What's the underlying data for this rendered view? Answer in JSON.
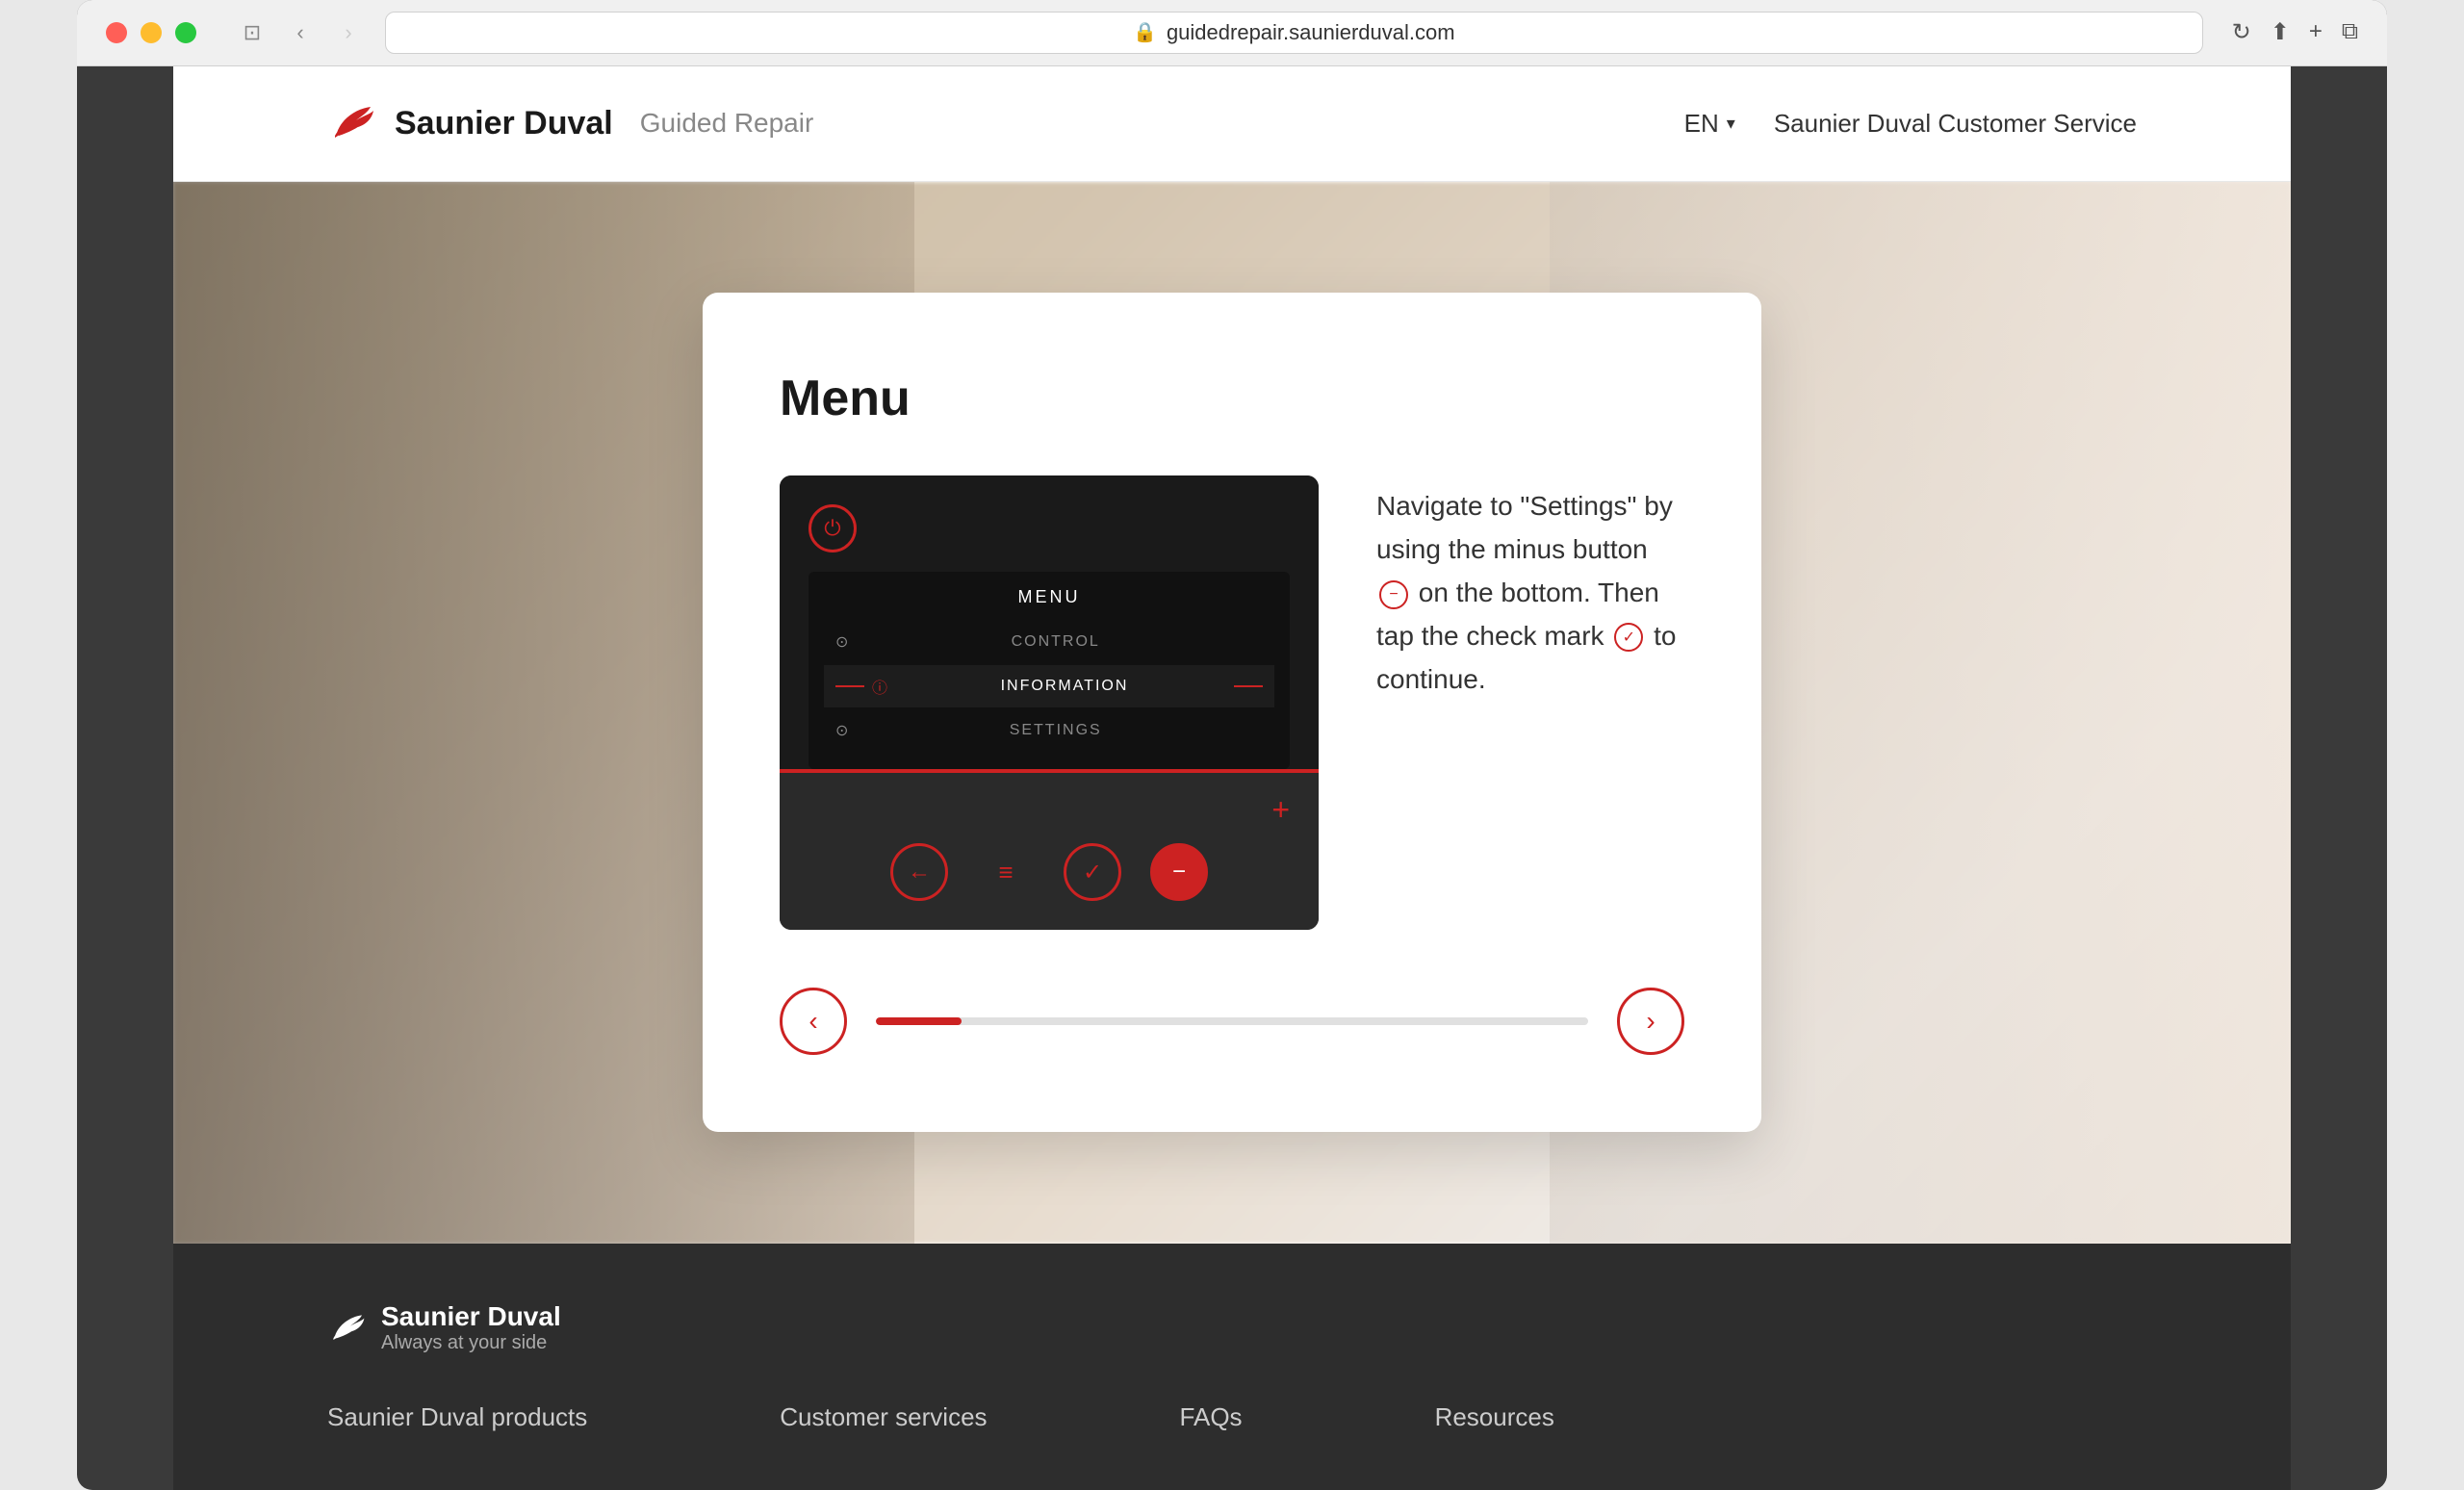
{
  "browser": {
    "url": "guidedrepair.saunierduval.com",
    "back_enabled": true,
    "forward_enabled": false
  },
  "header": {
    "logo_name": "Saunier Duval",
    "guided_repair_label": "Guided Repair",
    "lang_label": "EN",
    "customer_service_label": "Saunier Duval Customer Service"
  },
  "card": {
    "title": "Menu",
    "instructions": {
      "text_part1": "Navigate to \"Settings\" by using the minus button",
      "text_part2": "on the bottom. Then tap the check mark",
      "text_part3": "to continue."
    },
    "device": {
      "screen_title": "MENU",
      "menu_items": [
        {
          "label": "CONTROL",
          "icon": "⊙",
          "selected": false
        },
        {
          "label": "INFORMATION",
          "icon": "ⓘ",
          "selected": true
        },
        {
          "label": "SETTINGS",
          "icon": "⊙",
          "selected": false
        }
      ]
    },
    "progress": {
      "fill_percent": 12
    }
  },
  "footer": {
    "logo_name": "Saunier Duval",
    "tagline": "Always at your side",
    "links": [
      {
        "label": "Saunier Duval products"
      },
      {
        "label": "Customer services"
      },
      {
        "label": "FAQs"
      },
      {
        "label": "Resources"
      }
    ]
  }
}
